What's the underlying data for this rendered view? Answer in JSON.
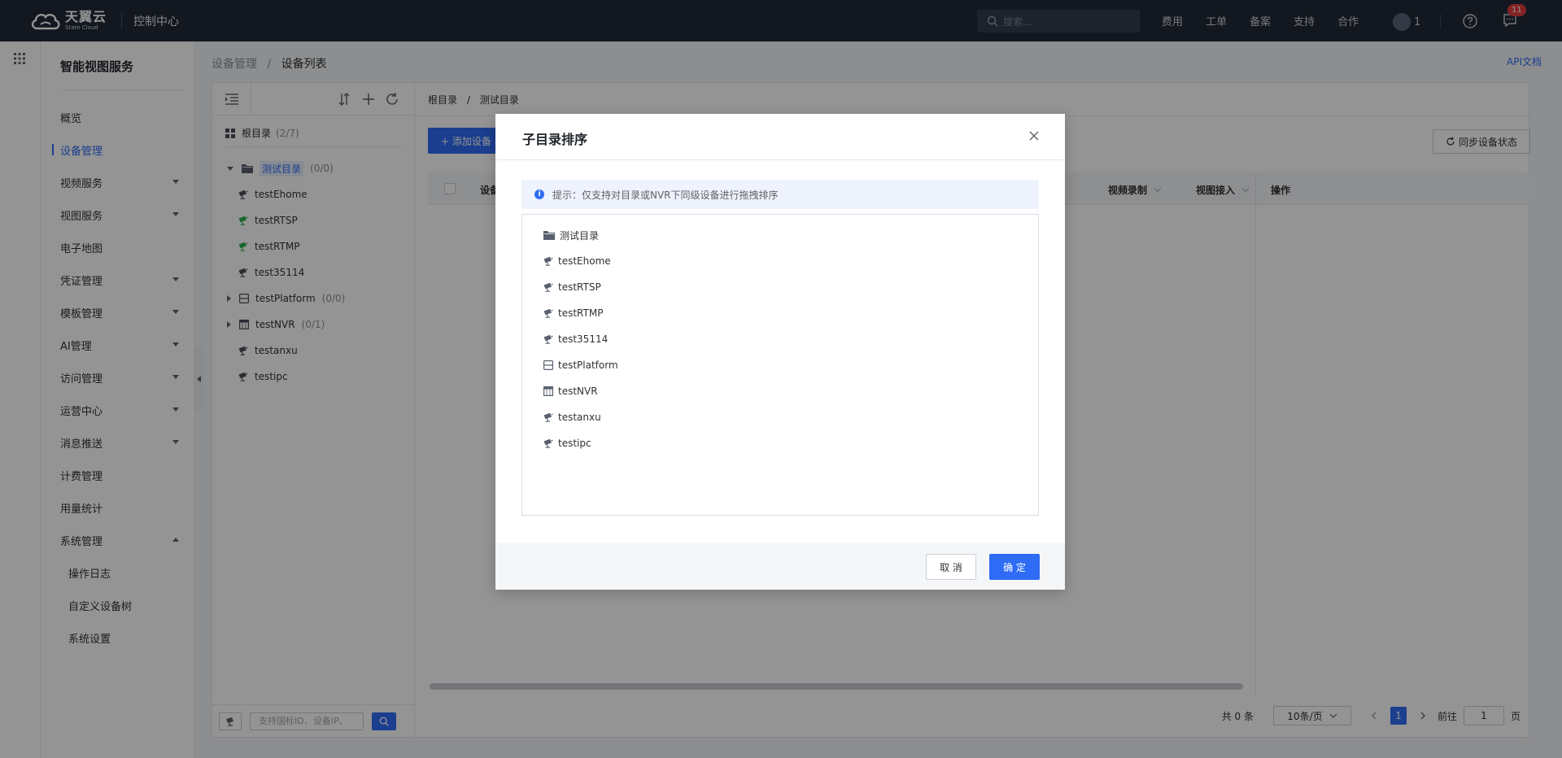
{
  "header": {
    "logo_cn": "天翼云",
    "logo_en": "State Cloud",
    "console": "控制中心",
    "search_placeholder": "搜索...",
    "links": [
      "费用",
      "工单",
      "备案",
      "支持",
      "合作"
    ],
    "user_suffix": "1",
    "message_badge": "11"
  },
  "sidebar": {
    "title": "智能视图服务",
    "items": [
      {
        "label": "概览",
        "caret": ""
      },
      {
        "label": "设备管理",
        "caret": "",
        "active": true
      },
      {
        "label": "视频服务",
        "caret": "down"
      },
      {
        "label": "视图服务",
        "caret": "down"
      },
      {
        "label": "电子地图",
        "caret": ""
      },
      {
        "label": "凭证管理",
        "caret": "down"
      },
      {
        "label": "模板管理",
        "caret": "down"
      },
      {
        "label": "AI管理",
        "caret": "down"
      },
      {
        "label": "访问管理",
        "caret": "down"
      },
      {
        "label": "运营中心",
        "caret": "down"
      },
      {
        "label": "消息推送",
        "caret": "down"
      },
      {
        "label": "计费管理",
        "caret": ""
      },
      {
        "label": "用量统计",
        "caret": ""
      },
      {
        "label": "系统管理",
        "caret": "up"
      }
    ],
    "sub_items": [
      "操作日志",
      "自定义设备树",
      "系统设置"
    ]
  },
  "breadcrumb": {
    "parent": "设备管理",
    "sep": "/",
    "current": "设备列表"
  },
  "api_doc": "API文档",
  "tree": {
    "root_label": "根目录",
    "root_count": "(2/7)",
    "nodes": [
      {
        "label": "测试目录",
        "count": "(0/0)",
        "icon": "folder-icon"
      },
      {
        "label": "testEhome",
        "count": "",
        "icon": "camera-icon"
      },
      {
        "label": "testRTSP",
        "count": "",
        "icon": "camera-online-icon"
      },
      {
        "label": "testRTMP",
        "count": "",
        "icon": "camera-online-icon"
      },
      {
        "label": "test35114",
        "count": "",
        "icon": "camera-icon"
      },
      {
        "label": "testPlatform",
        "count": "(0/0)",
        "icon": "platform-icon"
      },
      {
        "label": "testNVR",
        "count": "(0/1)",
        "icon": "nvr-icon"
      },
      {
        "label": "testanxu",
        "count": "",
        "icon": "camera-icon"
      },
      {
        "label": "testipc",
        "count": "",
        "icon": "camera-icon"
      }
    ],
    "search_placeholder": "支持国标ID、设备IP、"
  },
  "list": {
    "breadcrumb": {
      "root": "根目录",
      "sep": "/",
      "current": "测试目录"
    },
    "add_button": "+ 添加设备",
    "sync_button": "同步设备状态",
    "columns": {
      "device": "设备",
      "record": "视频录制",
      "access": "视图接入",
      "ops": "操作"
    },
    "pager": {
      "total": "共 0 条",
      "page_size": "10条/页",
      "current_page": "1",
      "goto_label": "前往",
      "goto_value": "1",
      "page_unit": "页"
    }
  },
  "modal": {
    "title": "子目录排序",
    "tip": "提示：仅支持对目录或NVR下同级设备进行拖拽排序",
    "items": [
      {
        "label": "测试目录",
        "icon": "folder-icon"
      },
      {
        "label": "testEhome",
        "icon": "camera-icon"
      },
      {
        "label": "testRTSP",
        "icon": "camera-icon"
      },
      {
        "label": "testRTMP",
        "icon": "camera-icon"
      },
      {
        "label": "test35114",
        "icon": "camera-icon"
      },
      {
        "label": "testPlatform",
        "icon": "platform-icon"
      },
      {
        "label": "testNVR",
        "icon": "nvr-icon"
      },
      {
        "label": "testanxu",
        "icon": "camera-icon"
      },
      {
        "label": "testipc",
        "icon": "camera-icon"
      }
    ],
    "cancel": "取 消",
    "ok": "确 定"
  },
  "colors": {
    "primary": "#2f6cf5",
    "topbar": "#222a37",
    "online": "#2bb24c"
  }
}
